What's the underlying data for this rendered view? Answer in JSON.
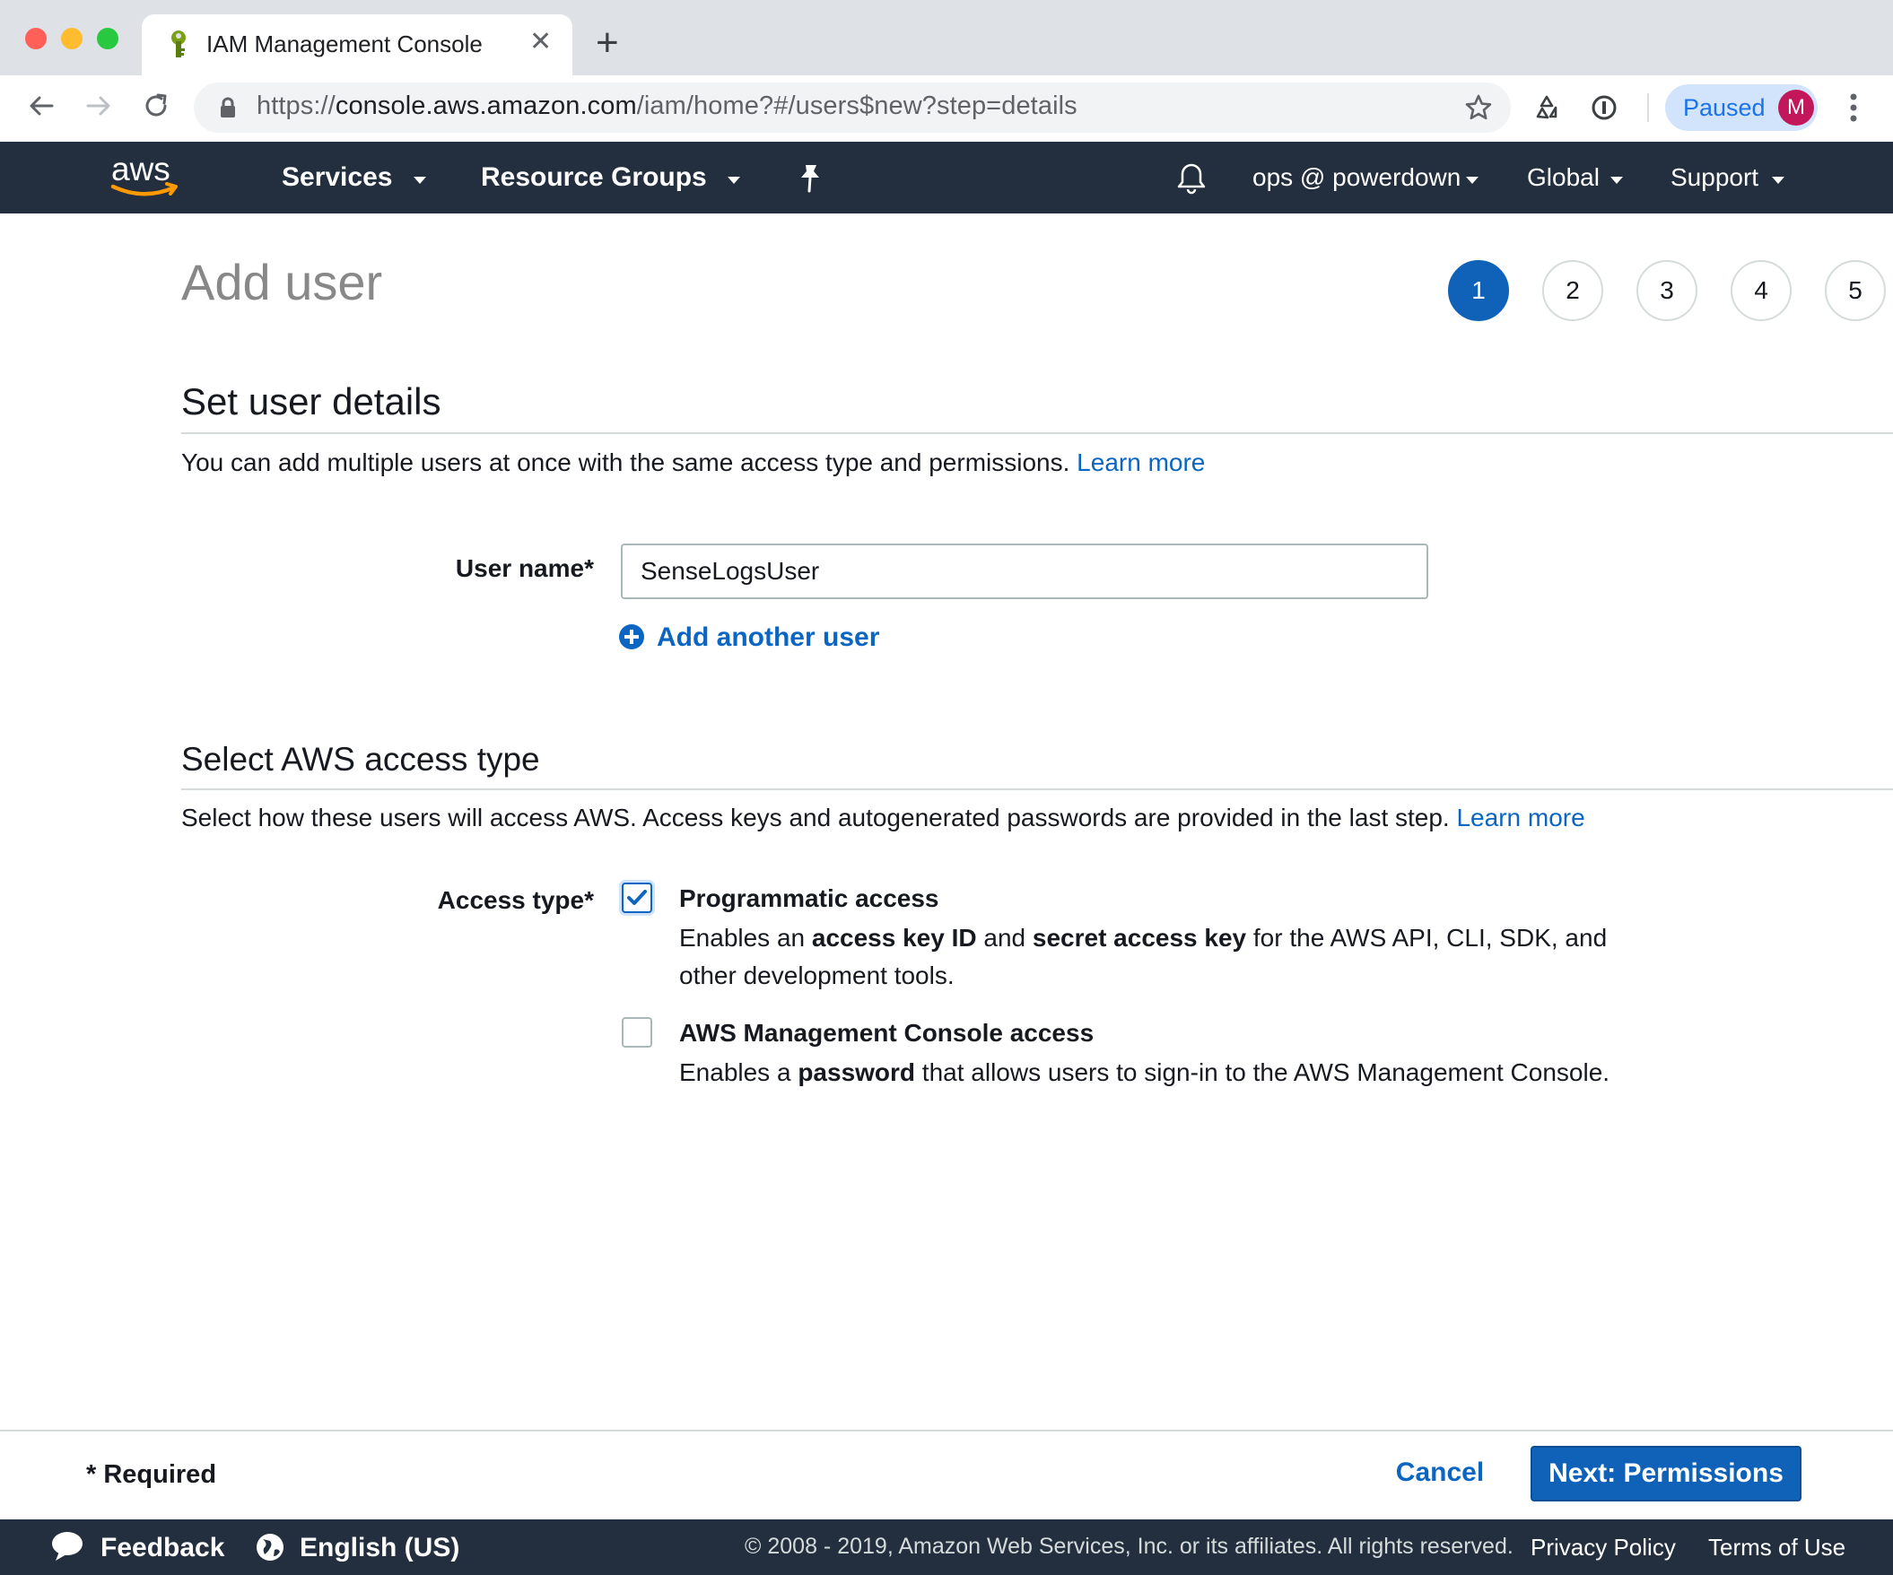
{
  "browser": {
    "tab_title": "IAM Management Console",
    "url_scheme": "https://",
    "url_host": "console.aws.amazon.com",
    "url_path": "/iam/home?#/users$new?step=details",
    "profile_status": "Paused",
    "avatar_initial": "M"
  },
  "aws_nav": {
    "services": "Services",
    "resource_groups": "Resource Groups",
    "account": "ops @ powerdown",
    "region": "Global",
    "support": "Support"
  },
  "page": {
    "title": "Add user",
    "steps": [
      "1",
      "2",
      "3",
      "4",
      "5"
    ],
    "active_step": 1
  },
  "user_details": {
    "heading": "Set user details",
    "description": "You can add multiple users at once with the same access type and permissions.",
    "learn_more": "Learn more",
    "username_label": "User name*",
    "username_value": "SenseLogsUser",
    "add_another": "Add another user"
  },
  "access_type": {
    "heading": "Select AWS access type",
    "description": "Select how these users will access AWS. Access keys and autogenerated passwords are provided in the last step.",
    "learn_more": "Learn more",
    "label": "Access type*",
    "options": [
      {
        "title": "Programmatic access",
        "checked": true,
        "desc_pre": "Enables an ",
        "desc_b1": "access key ID",
        "desc_mid": " and ",
        "desc_b2": "secret access key",
        "desc_post": " for the AWS API, CLI, SDK, and",
        "desc_line2": "other development tools."
      },
      {
        "title": "AWS Management Console access",
        "checked": false,
        "desc_pre": "Enables a ",
        "desc_b1": "password",
        "desc_post": " that allows users to sign-in to the AWS Management Console."
      }
    ]
  },
  "footer": {
    "required": "* Required",
    "cancel": "Cancel",
    "next": "Next: Permissions",
    "feedback": "Feedback",
    "language": "English (US)",
    "copyright": "© 2008 - 2019, Amazon Web Services, Inc. or its affiliates. All rights reserved.",
    "privacy": "Privacy Policy",
    "terms": "Terms of Use"
  },
  "colors": {
    "aws_nav_bg": "#232f3e",
    "primary_blue": "#0f62b8",
    "link_blue": "#0a66c2",
    "aws_orange": "#ff9900"
  },
  "icons": [
    "tab-favicon-icon",
    "close-icon",
    "plus-icon",
    "back-arrow-icon",
    "forward-arrow-icon",
    "reload-icon",
    "lock-icon",
    "star-icon",
    "recycle-icon",
    "info-icon",
    "kebab-menu-icon",
    "aws-logo",
    "chevron-down-icon",
    "pin-icon",
    "bell-icon",
    "add-circle-icon",
    "checkmark-icon",
    "feedback-bubble-icon",
    "globe-icon"
  ]
}
